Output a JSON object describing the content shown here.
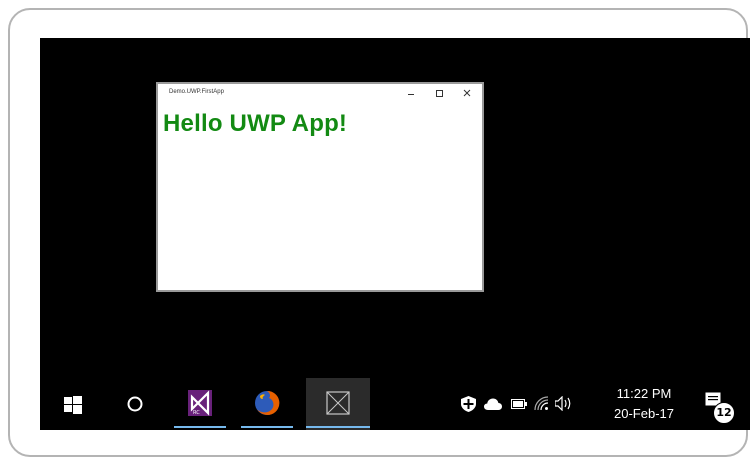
{
  "app_window": {
    "title": "Demo.UWP.FirstApp",
    "content_text": "Hello UWP App!",
    "content_color": "#138a13"
  },
  "taskbar": {
    "items": [
      {
        "name": "start-button",
        "icon": "windows-logo-icon"
      },
      {
        "name": "cortana-search",
        "icon": "circle-icon"
      },
      {
        "name": "visual-studio",
        "icon": "visual-studio-icon",
        "running": true
      },
      {
        "name": "firefox",
        "icon": "firefox-icon",
        "running": true
      },
      {
        "name": "demo-uwp-app",
        "icon": "uwp-app-icon",
        "active": true
      }
    ],
    "tray": {
      "icons": [
        "shield-icon",
        "onedrive-cloud-icon",
        "battery-icon",
        "wifi-icon",
        "volume-icon"
      ],
      "time": "11:22 PM",
      "date": "20-Feb-17",
      "notification_count": "12"
    }
  },
  "colors": {
    "desktop": "#000000",
    "accent": "#76b9ed",
    "visual_studio": "#68217a",
    "firefox": "#e66000"
  }
}
